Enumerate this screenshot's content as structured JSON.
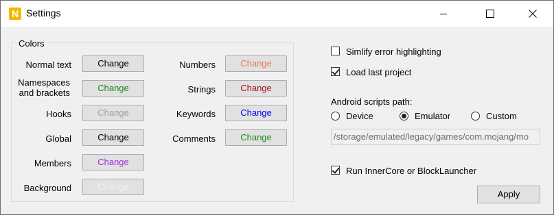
{
  "window": {
    "title": "Settings",
    "icon_letter": "N"
  },
  "colors_group": {
    "label": "Colors",
    "left": [
      {
        "label": "Normal text",
        "button": "Change",
        "color": "#000000"
      },
      {
        "label_line1": "Namespaces",
        "label_line2": "and brackets",
        "button": "Change",
        "color": "#1a8a1a"
      },
      {
        "label": "Hooks",
        "button": "Change",
        "color": "#a0a0a0"
      },
      {
        "label": "Global",
        "button": "Change",
        "color": "#000000"
      },
      {
        "label": "Members",
        "button": "Change",
        "color": "#9b30d9"
      },
      {
        "label": "Background",
        "button": "Change",
        "color": "#f0f0f0"
      }
    ],
    "right": [
      {
        "label": "Numbers",
        "button": "Change",
        "color": "#f07850"
      },
      {
        "label": "Strings",
        "button": "Change",
        "color": "#a31515"
      },
      {
        "label": "Keywords",
        "button": "Change",
        "color": "#0000ff"
      },
      {
        "label": "Comments",
        "button": "Change",
        "color": "#1a8a1a"
      }
    ]
  },
  "options": {
    "simplify_error": {
      "label": "Simlify error highlighting",
      "checked": false
    },
    "load_last_project": {
      "label": "Load last project",
      "checked": true
    },
    "android_path_label": "Android scripts path:",
    "radios": [
      {
        "label": "Device",
        "checked": false
      },
      {
        "label": "Emulator",
        "checked": true
      },
      {
        "label": "Custom",
        "checked": false
      }
    ],
    "path_value": "/storage/emulated/legacy/games/com.mojang/mo",
    "run_innercore": {
      "label": "Run InnerCore or BlockLauncher",
      "checked": true
    },
    "apply_label": "Apply"
  }
}
